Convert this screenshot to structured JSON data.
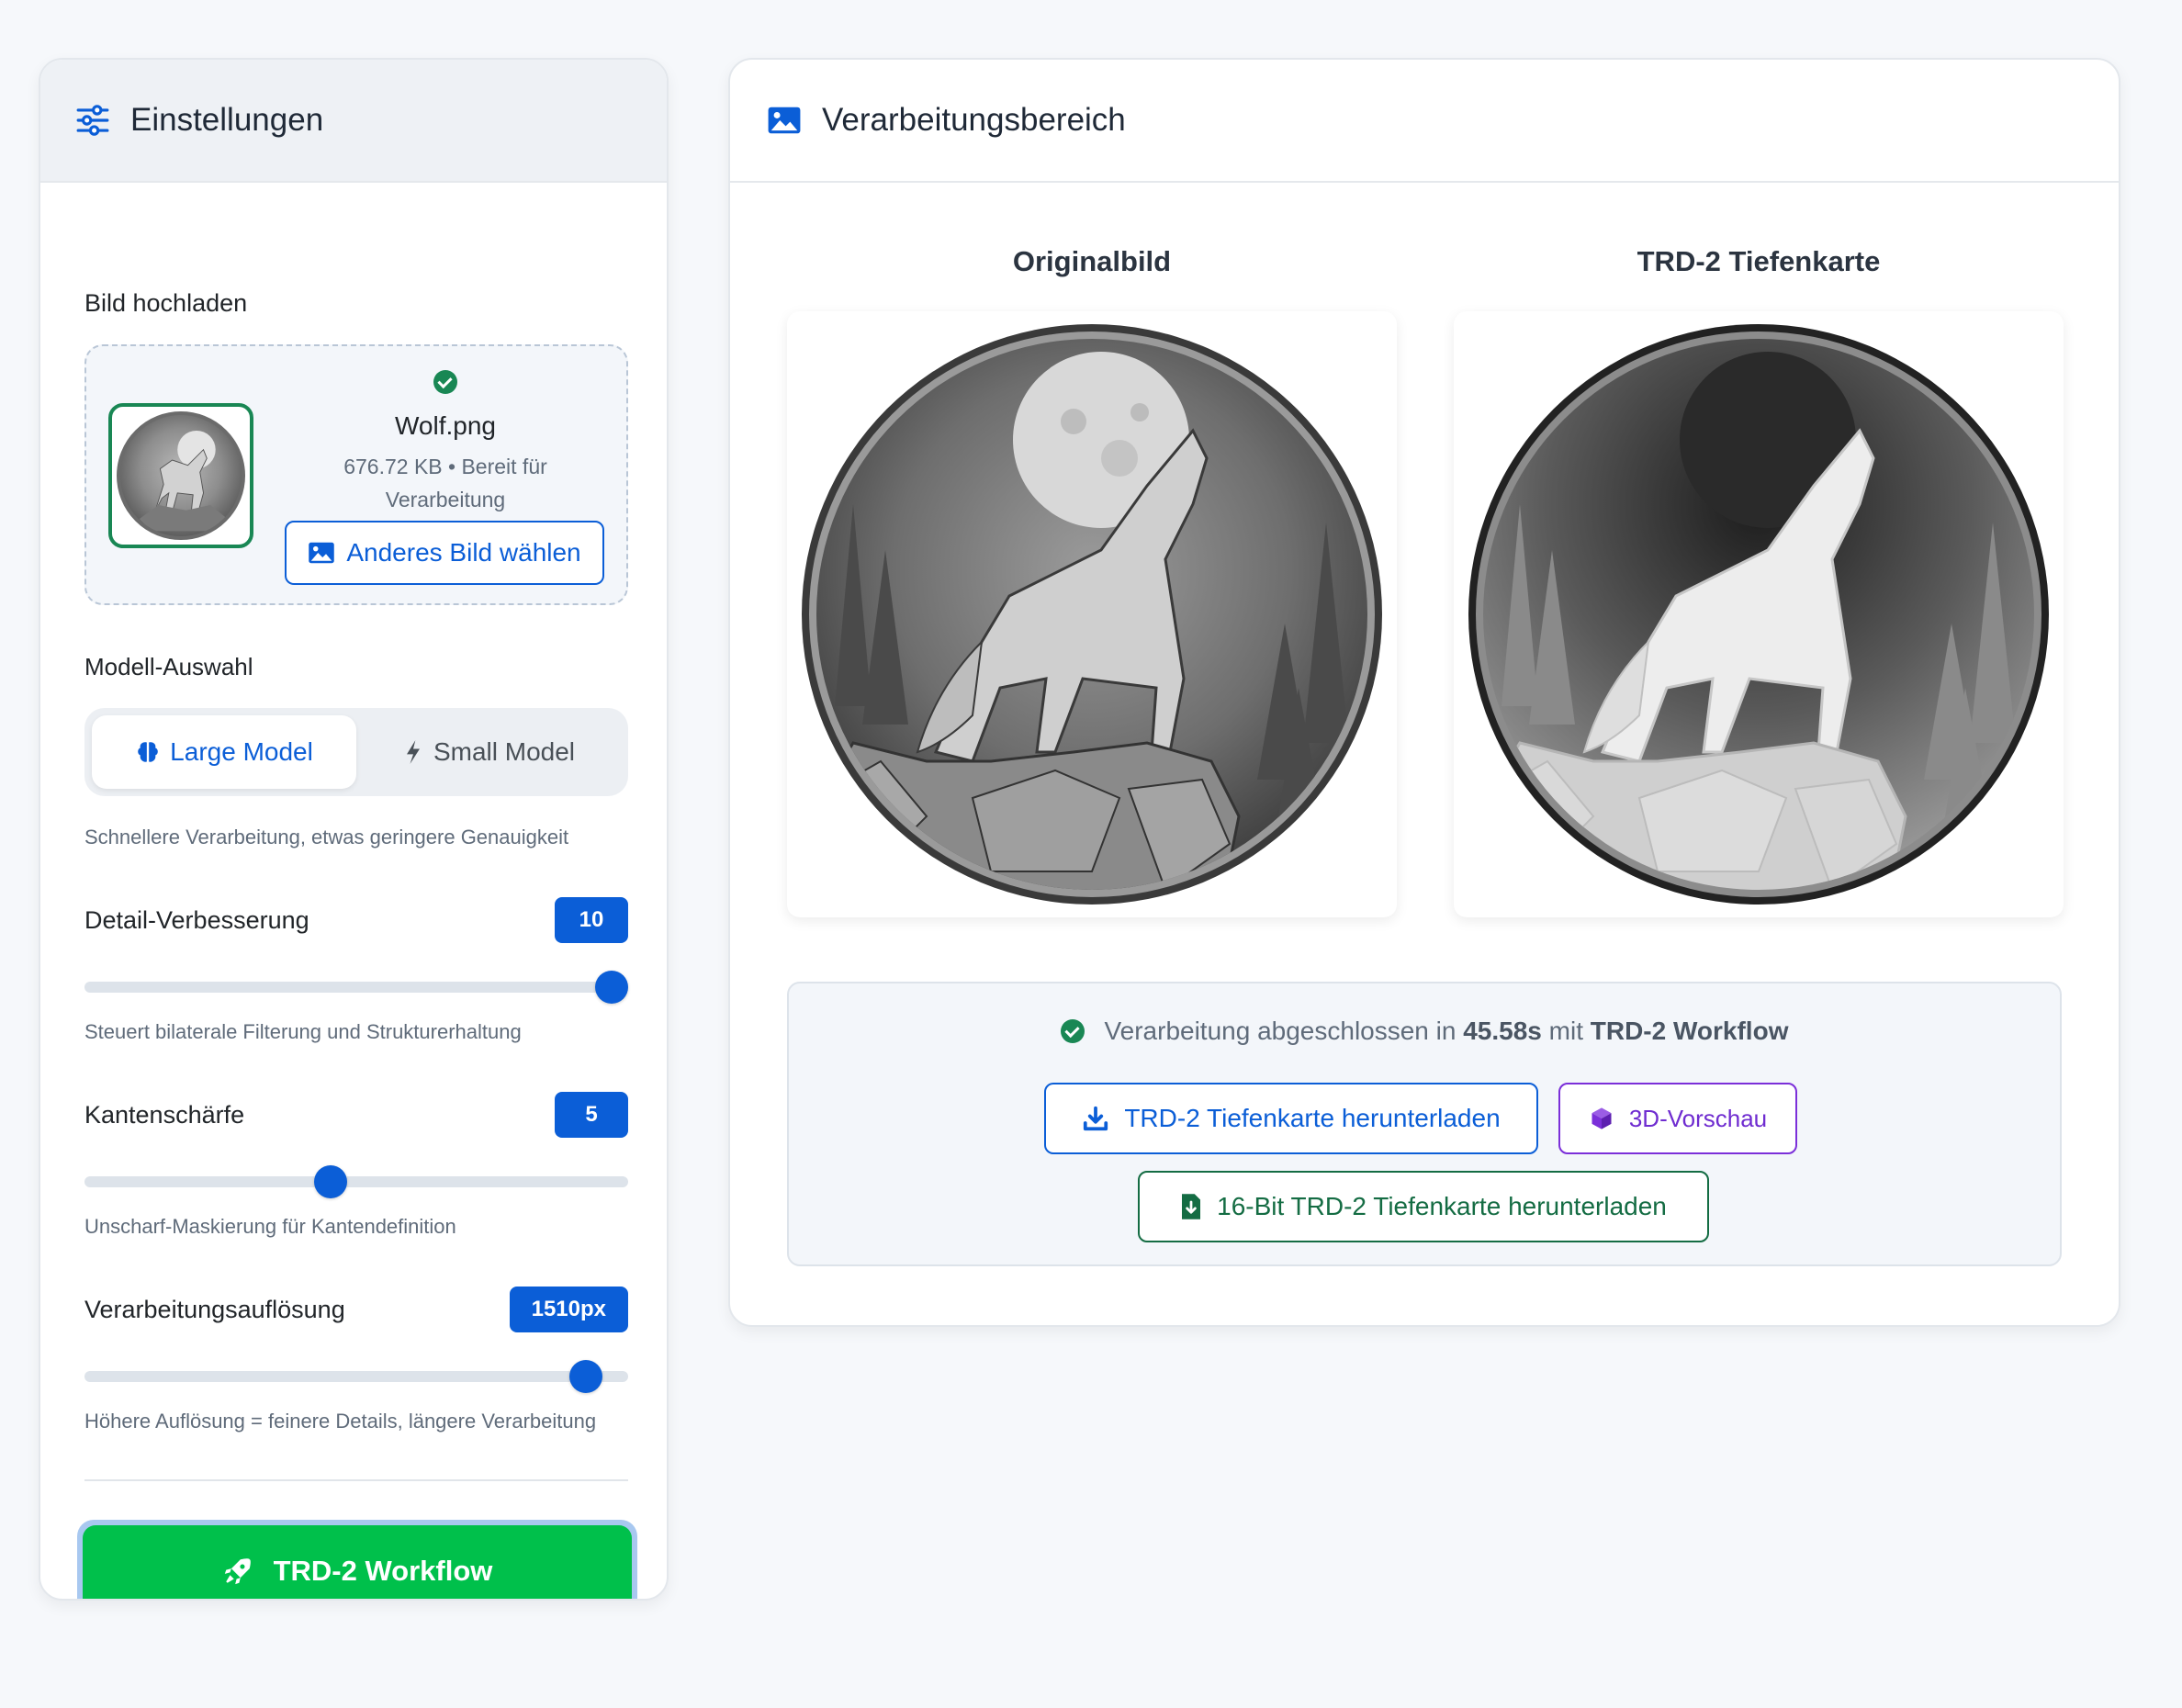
{
  "settings": {
    "title": "Einstellungen",
    "upload": {
      "label": "Bild hochladen",
      "file_name": "Wolf.png",
      "file_meta_line1": "676.72 KB • Bereit für",
      "file_meta_line2": "Verarbeitung",
      "change_button": "Anderes Bild wählen"
    },
    "model": {
      "label": "Modell-Auswahl",
      "options": [
        "Large Model",
        "Small Model"
      ],
      "selected": "Large Model",
      "hint": "Schnellere Verarbeitung, etwas geringere Genauigkeit"
    },
    "detail": {
      "label": "Detail-Verbesserung",
      "value": "10",
      "level": 1.0,
      "hint": "Steuert bilaterale Filterung und Strukturerhaltung"
    },
    "sharpness": {
      "label": "Kantenschärfe",
      "value": "5",
      "level": 0.45,
      "hint": "Unscharf-Maskierung für Kantendefinition"
    },
    "resolution": {
      "label": "Verarbeitungsauflösung",
      "value": "1510px",
      "level": 0.95,
      "hint": "Höhere Auflösung = feinere Details, längere Verarbeitung"
    },
    "run_button": "TRD-2 Workflow"
  },
  "processing": {
    "title": "Verarbeitungsbereich",
    "original_title": "Originalbild",
    "depth_title": "TRD-2 Tiefenkarte",
    "status_prefix": "Verarbeitung abgeschlossen in",
    "status_time": "45.58s",
    "status_mid": "mit",
    "status_workflow": "TRD-2 Workflow",
    "download_button": "TRD-2 Tiefenkarte herunterladen",
    "preview_button": "3D-Vorschau",
    "download16_button": "16-Bit TRD-2 Tiefenkarte herunterladen"
  },
  "colors": {
    "primary": "#0b5ed7",
    "success": "#198754",
    "run": "#00c04b",
    "purple": "#7b2fd9"
  }
}
